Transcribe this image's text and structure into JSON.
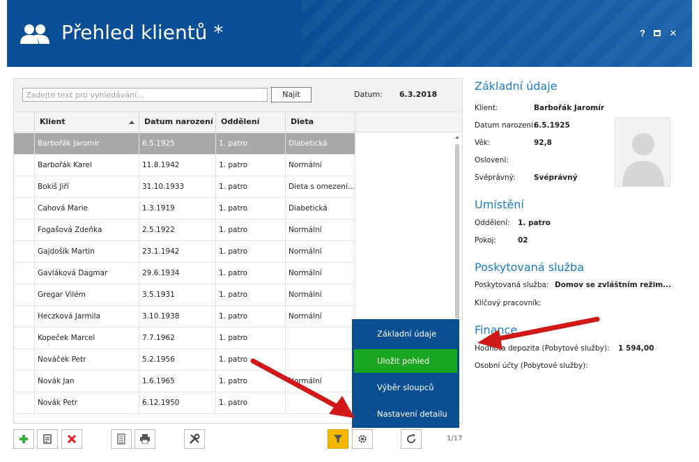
{
  "header": {
    "title": "Přehled klientů *",
    "help_label": "?",
    "close_label": "✕",
    "bg_color": "#0a4f96"
  },
  "search": {
    "placeholder": "Zadejte text pro vyhledávání...",
    "value": "",
    "find_label": "Najít",
    "date_label": "Datum:",
    "date_value": "6.3.2018"
  },
  "grid": {
    "columns": [
      "Klient",
      "Datum narození",
      "Oddělení",
      "Dieta"
    ],
    "sorted_column": "Klient",
    "rows": [
      {
        "klient": "Barbořák Jaromír",
        "datum": "6.5.1925",
        "oddeleni": "1. patro",
        "dieta": "Diabetická",
        "selected": true
      },
      {
        "klient": "Barbořák Karel",
        "datum": "11.8.1942",
        "oddeleni": "1. patro",
        "dieta": "Normální"
      },
      {
        "klient": "Bokiš Jiří",
        "datum": "31.10.1933",
        "oddeleni": "1. patro",
        "dieta": "Dieta s omezení..."
      },
      {
        "klient": "Cahová Marie",
        "datum": "1.3.1919",
        "oddeleni": "1. patro",
        "dieta": "Diabetická"
      },
      {
        "klient": "Fogašová Zdeňka",
        "datum": "2.5.1922",
        "oddeleni": "1. patro",
        "dieta": "Normální"
      },
      {
        "klient": "Gajdošík Martin",
        "datum": "23.1.1942",
        "oddeleni": "1. patro",
        "dieta": "Normální"
      },
      {
        "klient": "Gavláková Dagmar",
        "datum": "29.6.1934",
        "oddeleni": "1. patro",
        "dieta": "Normální"
      },
      {
        "klient": "Gregar Vilém",
        "datum": "3.5.1931",
        "oddeleni": "1. patro",
        "dieta": "Normální"
      },
      {
        "klient": "Heczková Jarmila",
        "datum": "3.10.1938",
        "oddeleni": "1. patro",
        "dieta": "Normální"
      },
      {
        "klient": "Kopeček Marcel",
        "datum": "7.7.1962",
        "oddeleni": "1. patro",
        "dieta": ""
      },
      {
        "klient": "Nováček Petr",
        "datum": "5.2.1956",
        "oddeleni": "1. patro",
        "dieta": ""
      },
      {
        "klient": "Novák Jan",
        "datum": "1.6.1965",
        "oddeleni": "1. patro",
        "dieta": "Normální"
      },
      {
        "klient": "Novák Petr",
        "datum": "6.12.1950",
        "oddeleni": "1. patro",
        "dieta": ""
      }
    ]
  },
  "toolbar": {
    "page_info": "1/17",
    "add_icon": "plus-icon",
    "edit_icon": "edit-icon",
    "delete_icon": "delete-icon",
    "report_icon": "document-icon",
    "print_icon": "printer-icon",
    "tools_icon": "tools-icon",
    "filter_icon": "filter-icon",
    "settings_icon": "gear-icon",
    "refresh_icon": "refresh-icon",
    "active_color": "#f5b800"
  },
  "popup_menu": {
    "items": [
      "Základní údaje",
      "Uložit pohled",
      "Výběr sloupců",
      "Nastavení detailu"
    ],
    "active_index": 1,
    "bg_color": "#0c4e92",
    "active_color": "#19a51f"
  },
  "detail": {
    "basic": {
      "title": "Základní údaje",
      "klient_label": "Klient:",
      "klient_value": "Barbořák Jaromír",
      "datum_label": "Datum narození:",
      "datum_value": "6.5.1925",
      "vek_label": "Věk:",
      "vek_value": "92,8",
      "osloveni_label": "Oslovení:",
      "osloveni_value": "",
      "svepravny_label": "Svéprávný:",
      "svepravny_value": "Svéprávný"
    },
    "umisteni": {
      "title": "Umístění",
      "oddeleni_label": "Oddělení:",
      "oddeleni_value": "1. patro",
      "pokoj_label": "Pokoj:",
      "pokoj_value": "02"
    },
    "sluzba": {
      "title": "Poskytovaná služba",
      "sluzba_label": "Poskytovaná služba:",
      "sluzba_value": "Domov se zvláštním režim...",
      "pracovnik_label": "Klíčový pracovník:",
      "pracovnik_value": ""
    },
    "finance": {
      "title": "Finance",
      "depozita_label": "Hodnota depozita (Pobytové služby):",
      "depozita_value": "1 594,00",
      "ucty_label": "Osobní účty (Pobytové služby):",
      "ucty_value": ""
    },
    "title_color": "#1a7cc9"
  },
  "annotation": {
    "arrow_color": "#d01818"
  }
}
